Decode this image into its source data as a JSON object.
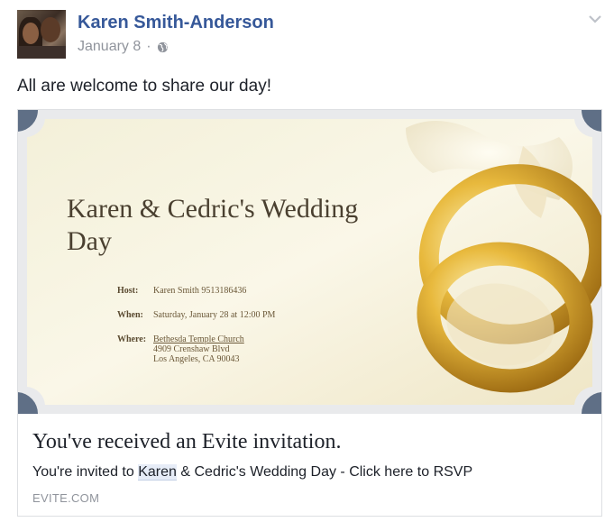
{
  "post": {
    "author": "Karen Smith-Anderson",
    "date": "January 8",
    "separator": "·",
    "message": "All are welcome to share our day!",
    "privacy_icon": "globe-icon",
    "menu_icon": "chevron-down-icon"
  },
  "invite_image": {
    "title": "Karen & Cedric's Wedding Day",
    "host_label": "Host:",
    "host_value": "Karen Smith  9513186436",
    "when_label": "When:",
    "when_value": "Saturday, January 28 at 12:00 PM",
    "where_label": "Where:",
    "where_name": "Bethesda Temple Church",
    "where_address1": "4909 Crenshaw Blvd",
    "where_address2": "Los Angeles, CA 90043"
  },
  "card": {
    "title": "You've received an Evite invitation.",
    "desc_before": "You're invited to ",
    "desc_highlight": "Karen",
    "desc_after": " & Cedric's Wedding Day - Click here to RSVP",
    "domain": "EVITE.COM"
  },
  "colors": {
    "author_link": "#365899",
    "meta_gray": "#90949c",
    "ticket_border": "#5f6f86"
  }
}
